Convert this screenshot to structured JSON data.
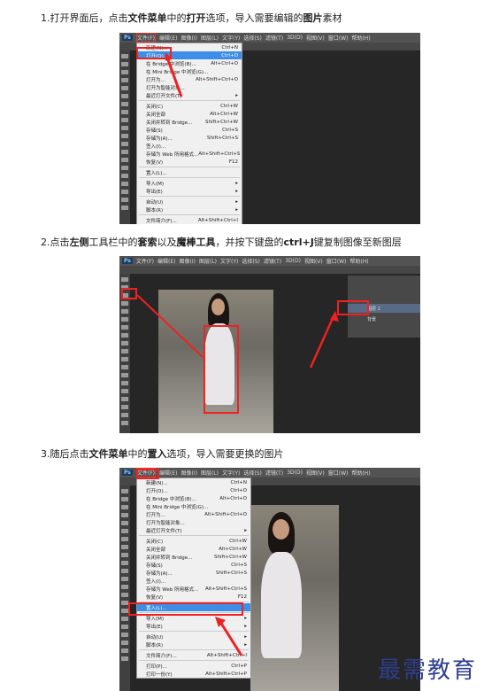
{
  "steps": [
    {
      "num": "1.",
      "parts": [
        "打开界面后，点击",
        "文件菜单",
        "中的",
        "打开",
        "选项，导入需要编辑的",
        "图片",
        "素材"
      ]
    },
    {
      "num": "2.",
      "parts": [
        "点击",
        "左侧",
        "工具栏中的",
        "套索",
        "以及",
        "魔棒工具",
        "，并按下键盘的",
        "ctrl+J",
        "键复制图像至新图层"
      ]
    },
    {
      "num": "3.",
      "parts": [
        "随后点击",
        "文件菜单",
        "中的",
        "置入",
        "选项，导入需要更换的图片"
      ]
    }
  ],
  "shot1": {
    "menubar": [
      "文件(F)",
      "编辑(E)",
      "图像(I)",
      "图层(L)",
      "文字(Y)",
      "选择(S)",
      "滤镜(T)",
      "3D(D)",
      "视图(V)",
      "窗口(W)",
      "帮助(H)"
    ],
    "menu": [
      [
        "新建(N)...",
        "Ctrl+N"
      ],
      [
        "打开(O)...",
        "Ctrl+O"
      ],
      [
        "在 Bridge 中浏览(B)...",
        "Alt+Ctrl+O"
      ],
      [
        "在 Mini Bridge 中浏览(G)...",
        ""
      ],
      [
        "打开为...",
        "Alt+Shift+Ctrl+O"
      ],
      [
        "打开为智能对象...",
        ""
      ],
      [
        "最近打开文件(T)",
        "▸"
      ],
      [
        "关闭(C)",
        "Ctrl+W"
      ],
      [
        "关闭全部",
        "Alt+Ctrl+W"
      ],
      [
        "关闭并转到 Bridge...",
        "Shift+Ctrl+W"
      ],
      [
        "存储(S)",
        "Ctrl+S"
      ],
      [
        "存储为(A)...",
        "Shift+Ctrl+S"
      ],
      [
        "签入(I)...",
        ""
      ],
      [
        "存储为 Web 所用格式...",
        "Alt+Shift+Ctrl+S"
      ],
      [
        "恢复(V)",
        "F12"
      ],
      [
        "置入(L)...",
        ""
      ],
      [
        "导入(M)",
        "▸"
      ],
      [
        "导出(E)",
        "▸"
      ],
      [
        "自动(U)",
        "▸"
      ],
      [
        "脚本(R)",
        "▸"
      ],
      [
        "文件简介(F)...",
        "Alt+Shift+Ctrl+I"
      ]
    ]
  },
  "shot2": {
    "layers": [
      "图层 1",
      "背景"
    ]
  },
  "shot3": {
    "menubar": [
      "文件(F)",
      "编辑(E)",
      "图像(I)",
      "图层(L)",
      "文字(Y)",
      "选择(S)",
      "滤镜(T)",
      "3D(D)",
      "视图(V)",
      "窗口(W)",
      "帮助(H)"
    ],
    "menu": [
      [
        "新建(N)...",
        "Ctrl+N"
      ],
      [
        "打开(O)...",
        "Ctrl+O"
      ],
      [
        "在 Bridge 中浏览(B)...",
        "Alt+Ctrl+O"
      ],
      [
        "在 Mini Bridge 中浏览(G)...",
        ""
      ],
      [
        "打开为...",
        "Alt+Shift+Ctrl+O"
      ],
      [
        "打开为智能对象...",
        ""
      ],
      [
        "最近打开文件(T)",
        "▸"
      ],
      [
        "关闭(C)",
        "Ctrl+W"
      ],
      [
        "关闭全部",
        "Alt+Ctrl+W"
      ],
      [
        "关闭并转到 Bridge...",
        "Shift+Ctrl+W"
      ],
      [
        "存储(S)",
        "Ctrl+S"
      ],
      [
        "存储为(A)...",
        "Shift+Ctrl+S"
      ],
      [
        "签入(I)...",
        ""
      ],
      [
        "存储为 Web 所用格式...",
        "Alt+Shift+Ctrl+S"
      ],
      [
        "恢复(V)",
        "F12"
      ],
      [
        "置入(L)...",
        ""
      ],
      [
        "导入(M)",
        "▸"
      ],
      [
        "导出(E)",
        "▸"
      ],
      [
        "自动(U)",
        "▸"
      ],
      [
        "脚本(R)",
        "▸"
      ],
      [
        "文件简介(F)...",
        "Alt+Shift+Ctrl+I"
      ],
      [
        "打印(P)...",
        "Ctrl+P"
      ],
      [
        "打印一份(Y)",
        "Alt+Shift+Ctrl+P"
      ]
    ]
  },
  "watermark": "最需教育"
}
